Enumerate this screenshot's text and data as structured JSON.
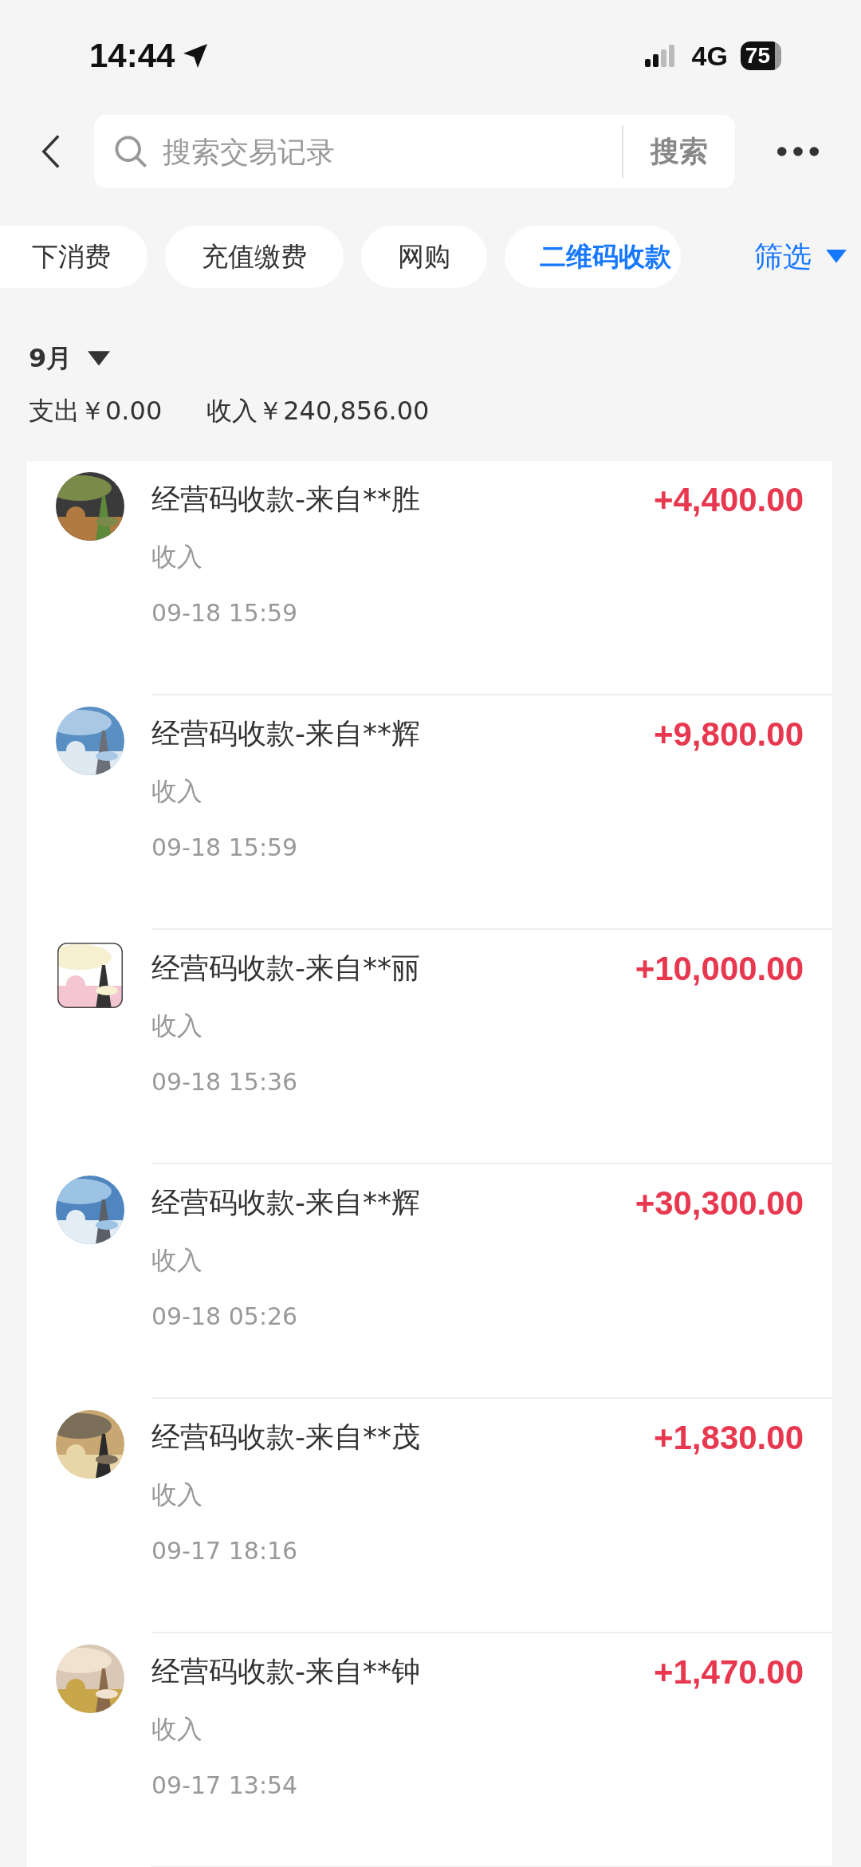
{
  "status_bar": {
    "time": "14:44",
    "network": "4G",
    "battery": "75"
  },
  "search": {
    "placeholder": "搜索交易记录",
    "button": "搜索"
  },
  "chips": [
    {
      "label": "下消费",
      "selected": false
    },
    {
      "label": "充值缴费",
      "selected": false
    },
    {
      "label": "网购",
      "selected": false
    },
    {
      "label": "二维码收款",
      "selected": true
    }
  ],
  "filter": "筛选",
  "month": "9月",
  "summary": {
    "expense": "支出￥0.00",
    "income": "收入￥240,856.00"
  },
  "transactions": [
    {
      "title": "经营码收款-来自**胜",
      "type": "收入",
      "time": "09-18 15:59",
      "amount": "+4,400.00"
    },
    {
      "title": "经营码收款-来自**辉",
      "type": "收入",
      "time": "09-18 15:59",
      "amount": "+9,800.00"
    },
    {
      "title": "经营码收款-来自**丽",
      "type": "收入",
      "time": "09-18 15:36",
      "amount": "+10,000.00"
    },
    {
      "title": "经营码收款-来自**辉",
      "type": "收入",
      "time": "09-18 05:26",
      "amount": "+30,300.00"
    },
    {
      "title": "经营码收款-来自**茂",
      "type": "收入",
      "time": "09-17 18:16",
      "amount": "+1,830.00"
    },
    {
      "title": "经营码收款-来自**钟",
      "type": "收入",
      "time": "09-17 13:54",
      "amount": "+1,470.00"
    }
  ]
}
